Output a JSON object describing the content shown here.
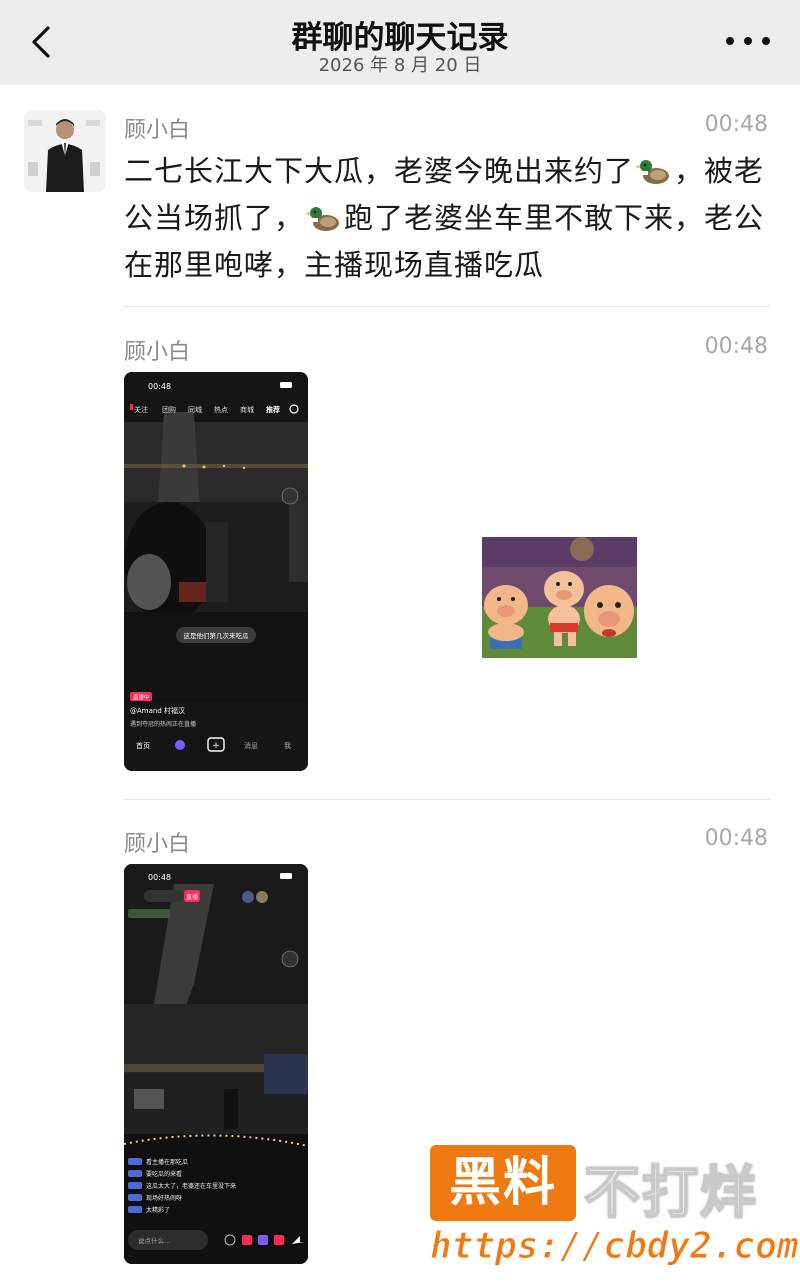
{
  "header": {
    "title": "群聊的聊天记录",
    "date": "2026 年 8 月 20 日"
  },
  "messages": [
    {
      "sender": "顾小白",
      "time": "00:48",
      "text_parts": [
        "二七长江大下大瓜，老婆今晚出来约了",
        "，被老公当场抓了，",
        "跑了老婆坐车里不敢下来，老公在那里咆哮，主播现场直播吃瓜"
      ]
    },
    {
      "sender": "顾小白",
      "time": "00:48",
      "screenshot": {
        "status_time": "00:48",
        "tabs": [
          "关注",
          "团购",
          "同城",
          "热点",
          "商城",
          "推荐"
        ],
        "overlay": "这是他们第几次来吃瓜",
        "live_badge": "直播中",
        "username": "@Amand 村福汉",
        "caption": "遇到夺冠的热闹正在直播",
        "nav": [
          "首页",
          "朋友",
          "+",
          "消息",
          "我"
        ]
      },
      "sticker": "three-pigs-sticker"
    },
    {
      "sender": "顾小白",
      "time": "00:48",
      "screenshot": {
        "status_time": "00:48",
        "live_tag": "直播",
        "comments": [
          "看主播在那吃瓜",
          "要吃瓜的来看",
          "这瓜太大了，老婆还在车里没下来",
          "现场好热闹呀",
          "太精彩了"
        ],
        "input_placeholder": "说点什么..."
      }
    }
  ],
  "watermark": {
    "box_text": "黑料",
    "text": "不打烊",
    "url": "https://cbdy2.com"
  },
  "colors": {
    "header_bg": "#ededed",
    "watermark_orange": "#f07a12",
    "live_pink": "#fe2c55"
  }
}
